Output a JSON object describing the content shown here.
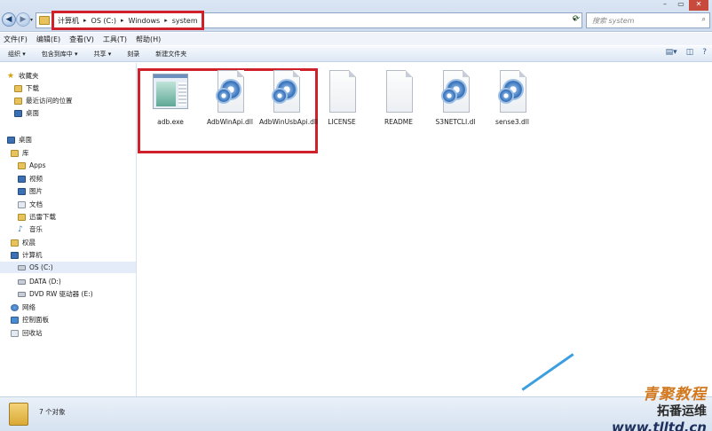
{
  "address": {
    "crumbs": [
      "计算机",
      "OS (C:)",
      "Windows",
      "system"
    ],
    "separator": "▸",
    "search_placeholder": "搜索 system"
  },
  "menu": [
    "文件(F)",
    "编辑(E)",
    "查看(V)",
    "工具(T)",
    "帮助(H)"
  ],
  "toolbar": {
    "organize": "组织 ▾",
    "include": "包含到库中 ▾",
    "share": "共享 ▾",
    "burn": "刻录",
    "new_folder": "新建文件夹"
  },
  "nav": {
    "favorites": "收藏夹",
    "downloads": "下载",
    "recent": "最近访问的位置",
    "desktop_fav": "桌面",
    "desktop": "桌面",
    "libraries": "库",
    "apps": "Apps",
    "videos": "视频",
    "pictures": "图片",
    "documents": "文档",
    "xunlei": "迅雷下载",
    "music": "音乐",
    "user": "权晨",
    "computer": "计算机",
    "drive_c": "OS (C:)",
    "drive_d": "DATA (D:)",
    "drive_e": "DVD RW 驱动器 (E:)",
    "network": "网络",
    "control_panel": "控制面板",
    "recycle_bin": "回收站"
  },
  "files": [
    {
      "name": "adb.exe",
      "icon": "exe-window-icon"
    },
    {
      "name": "AdbWinApi.dll",
      "icon": "dll-gear-icon"
    },
    {
      "name": "AdbWinUsbApi.dll",
      "icon": "dll-gear-icon"
    },
    {
      "name": "LICENSE",
      "icon": "blank-file-icon"
    },
    {
      "name": "README",
      "icon": "blank-file-icon"
    },
    {
      "name": "S3NETCLI.dl",
      "icon": "dll-gear-icon"
    },
    {
      "name": "sense3.dll",
      "icon": "dll-gear-icon"
    }
  ],
  "status": {
    "count": "7 个对象"
  },
  "watermark": {
    "line1": "青聚教程",
    "line2": "拓番运维",
    "url": "www.tlltd.cn"
  },
  "colors": {
    "highlight": "#d0202a",
    "accent": "#3d6fb3"
  }
}
